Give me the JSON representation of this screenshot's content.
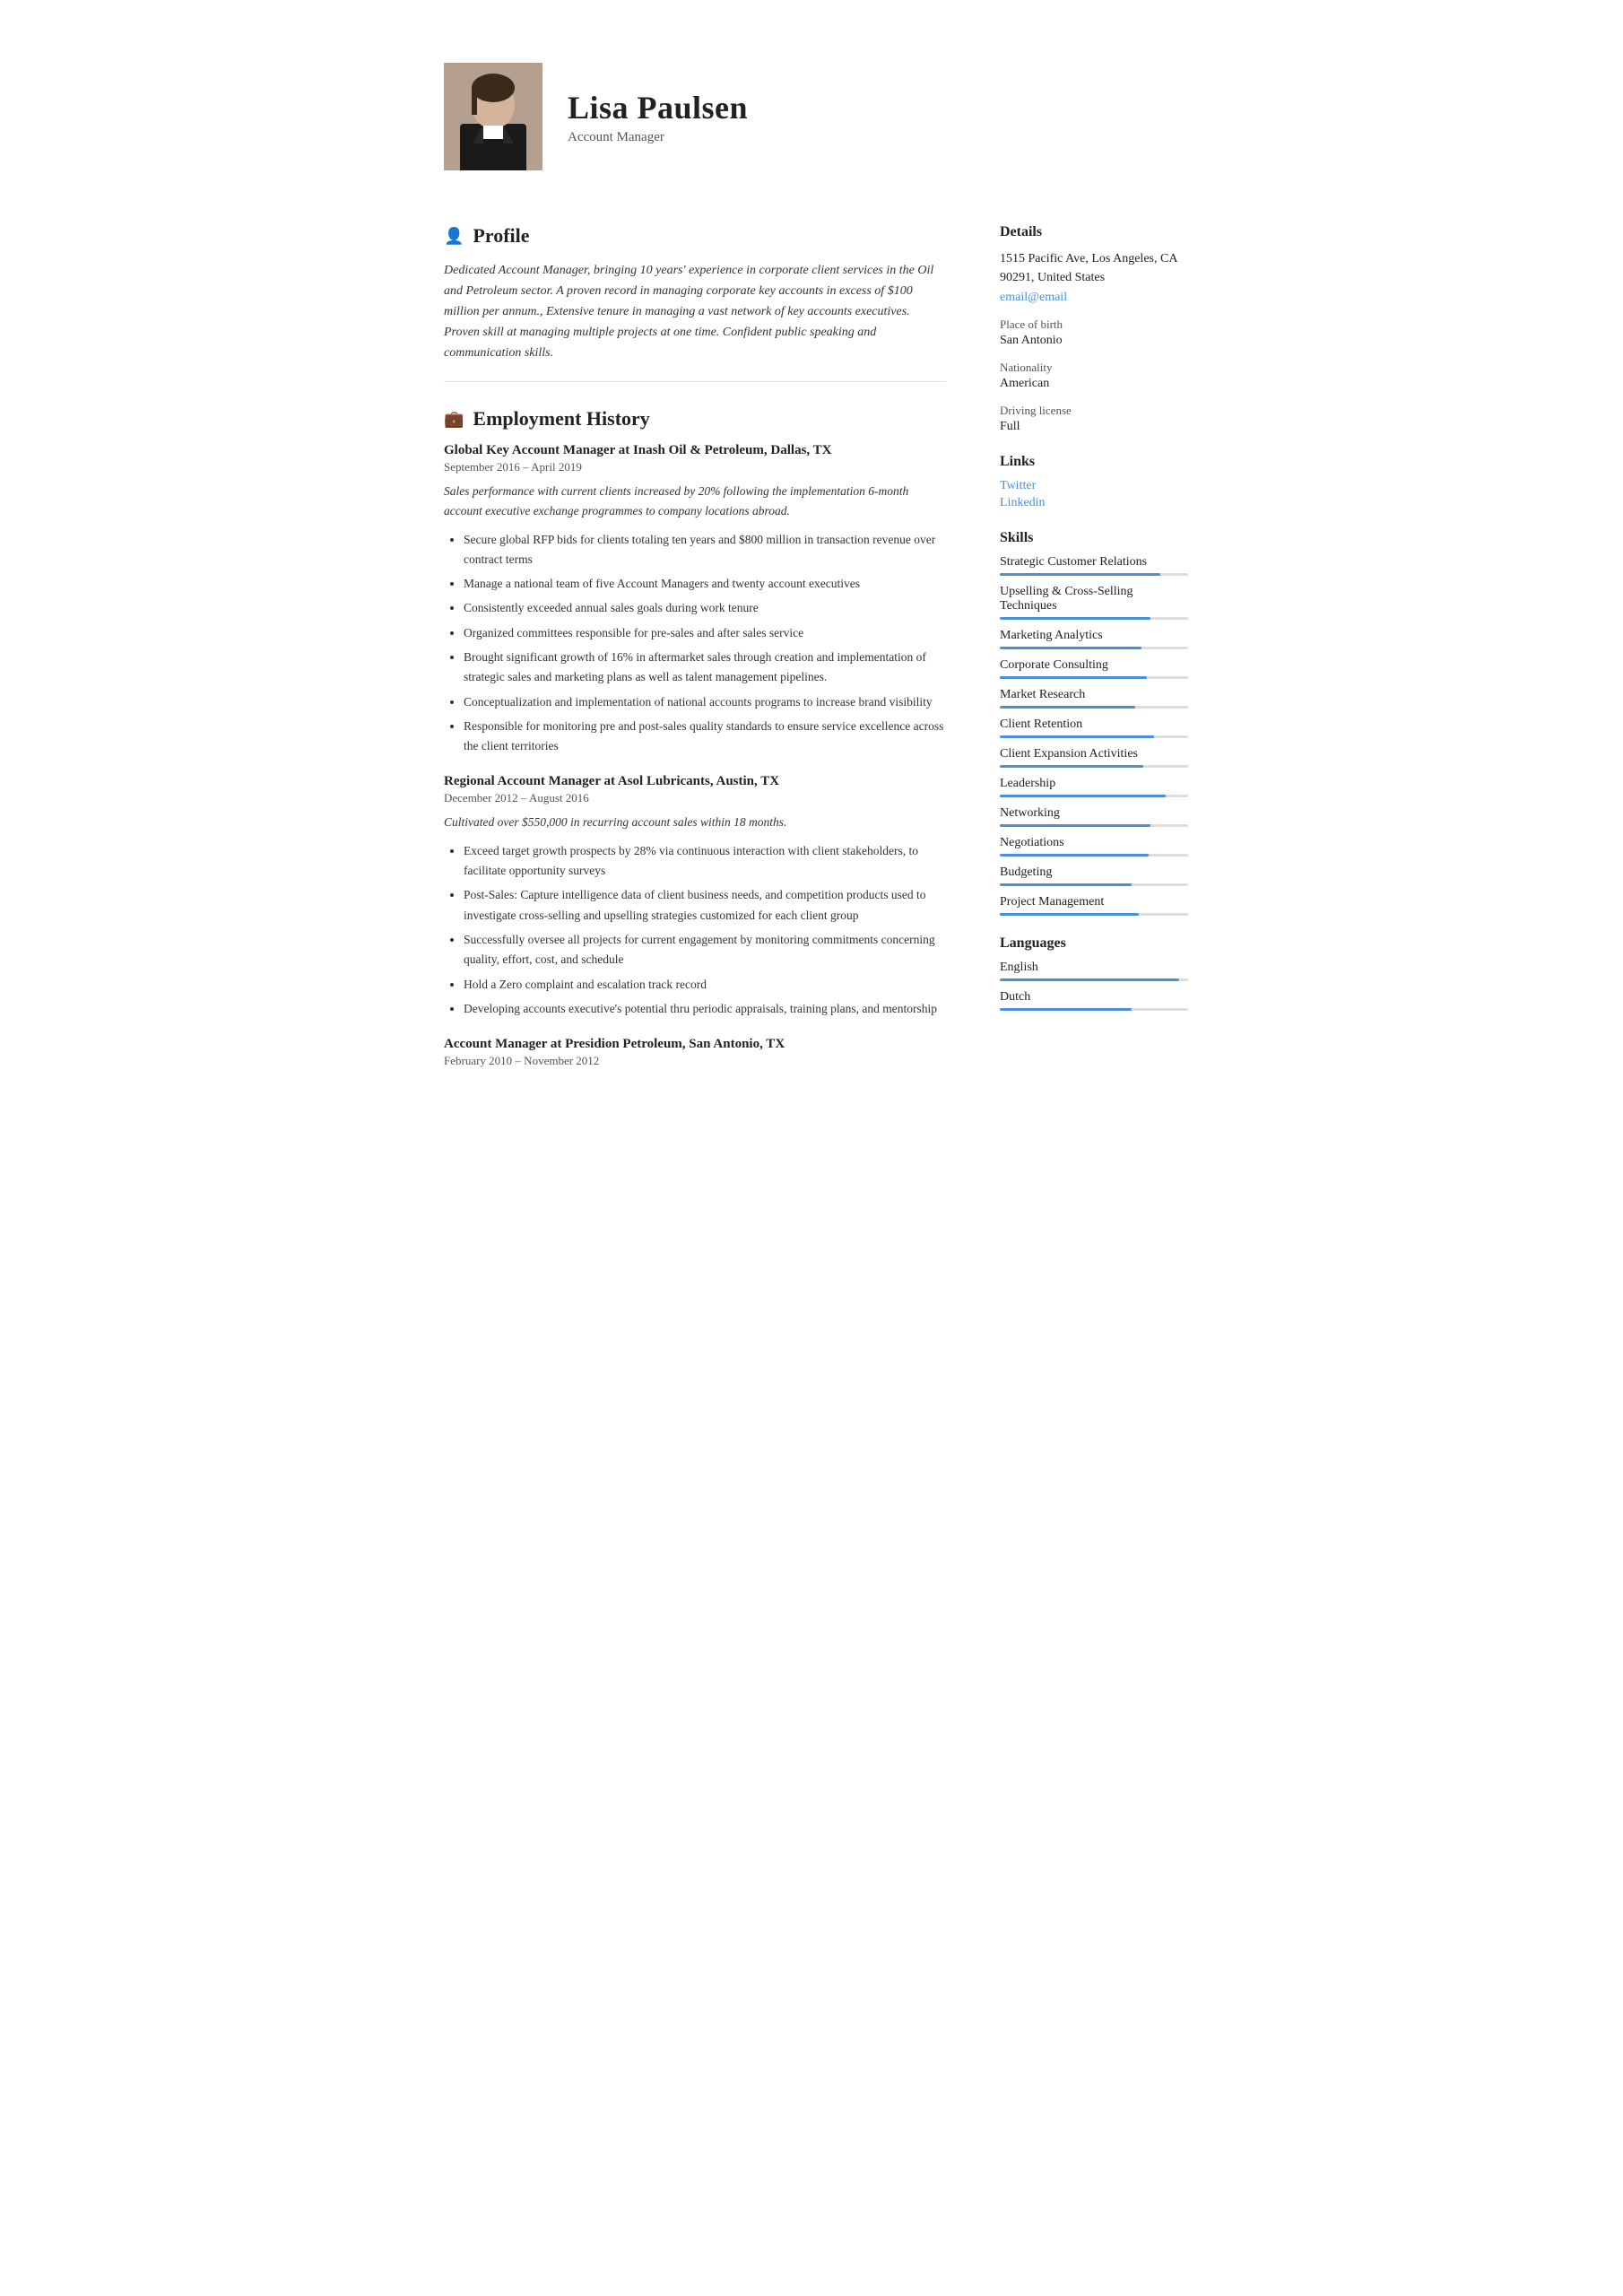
{
  "header": {
    "name": "Lisa Paulsen",
    "title": "Account Manager"
  },
  "profile": {
    "section_label": "Profile",
    "text": "Dedicated Account Manager, bringing 10 years' experience in corporate client services in the Oil and Petroleum sector.  A proven record in managing corporate key accounts in excess of $100 million per annum., Extensive tenure in managing a vast network of key accounts executives. Proven skill at managing multiple projects at one time. Confident public speaking and communication skills."
  },
  "employment": {
    "section_label": "Employment History",
    "jobs": [
      {
        "title": "Global Key Account Manager at Inash Oil & Petroleum, Dallas, TX",
        "dates": "September 2016  –  April 2019",
        "summary": "Sales performance with current clients increased by 20% following the implementation 6-month account executive exchange programmes to company locations abroad.",
        "bullets": [
          "Secure global RFP bids for clients totaling ten years and $800 million in transaction revenue over contract terms",
          "Manage a national team of five Account Managers and twenty account executives",
          "Consistently exceeded annual sales goals during work tenure",
          "Organized committees responsible for pre-sales and after sales service",
          "Brought significant growth of 16% in aftermarket sales through creation and implementation of strategic sales and marketing plans as well as talent management pipelines.",
          "Conceptualization and implementation of national accounts programs to increase brand visibility",
          "Responsible for monitoring pre and post-sales quality standards to ensure service excellence across the client territories"
        ]
      },
      {
        "title": "Regional Account Manager at Asol Lubricants, Austin, TX",
        "dates": "December 2012  –  August 2016",
        "summary": "Cultivated over $550,000 in recurring account sales within 18 months.",
        "bullets": [
          "Exceed target growth prospects by 28% via continuous interaction with client stakeholders, to facilitate opportunity surveys",
          "Post-Sales: Capture intelligence data of client business needs, and competition products used to investigate cross-selling and upselling strategies customized for each client group",
          "Successfully oversee all projects for current engagement by monitoring commitments concerning quality, effort, cost, and schedule",
          "Hold a Zero complaint and escalation track record",
          "Developing accounts executive's potential thru periodic appraisals, training plans, and mentorship"
        ]
      },
      {
        "title": "Account Manager at Presidion Petroleum, San Antonio, TX",
        "dates": "February 2010  –  November 2012",
        "summary": "",
        "bullets": []
      }
    ]
  },
  "details": {
    "section_label": "Details",
    "address": "1515 Pacific Ave, Los Angeles, CA 90291, United States",
    "email": "email@email",
    "place_of_birth_label": "Place of birth",
    "place_of_birth": "San Antonio",
    "nationality_label": "Nationality",
    "nationality": "American",
    "driving_license_label": "Driving license",
    "driving_license": "Full"
  },
  "links": {
    "section_label": "Links",
    "items": [
      {
        "label": "Twitter",
        "url": "#"
      },
      {
        "label": "Linkedin",
        "url": "#"
      }
    ]
  },
  "skills": {
    "section_label": "Skills",
    "items": [
      {
        "name": "Strategic Customer Relations",
        "fill": 85
      },
      {
        "name": "Upselling & Cross-Selling Techniques",
        "fill": 80
      },
      {
        "name": "Marketing Analytics",
        "fill": 75
      },
      {
        "name": "Corporate Consulting",
        "fill": 78
      },
      {
        "name": "Market Research",
        "fill": 72
      },
      {
        "name": "Client Retention",
        "fill": 82
      },
      {
        "name": "Client Expansion Activities",
        "fill": 76
      },
      {
        "name": "Leadership",
        "fill": 88
      },
      {
        "name": "Networking",
        "fill": 80
      },
      {
        "name": "Negotiations",
        "fill": 79
      },
      {
        "name": "Budgeting",
        "fill": 70
      },
      {
        "name": "Project Management",
        "fill": 74
      }
    ]
  },
  "languages": {
    "section_label": "Languages",
    "items": [
      {
        "name": "English",
        "fill": 95
      },
      {
        "name": "Dutch",
        "fill": 70
      }
    ]
  }
}
